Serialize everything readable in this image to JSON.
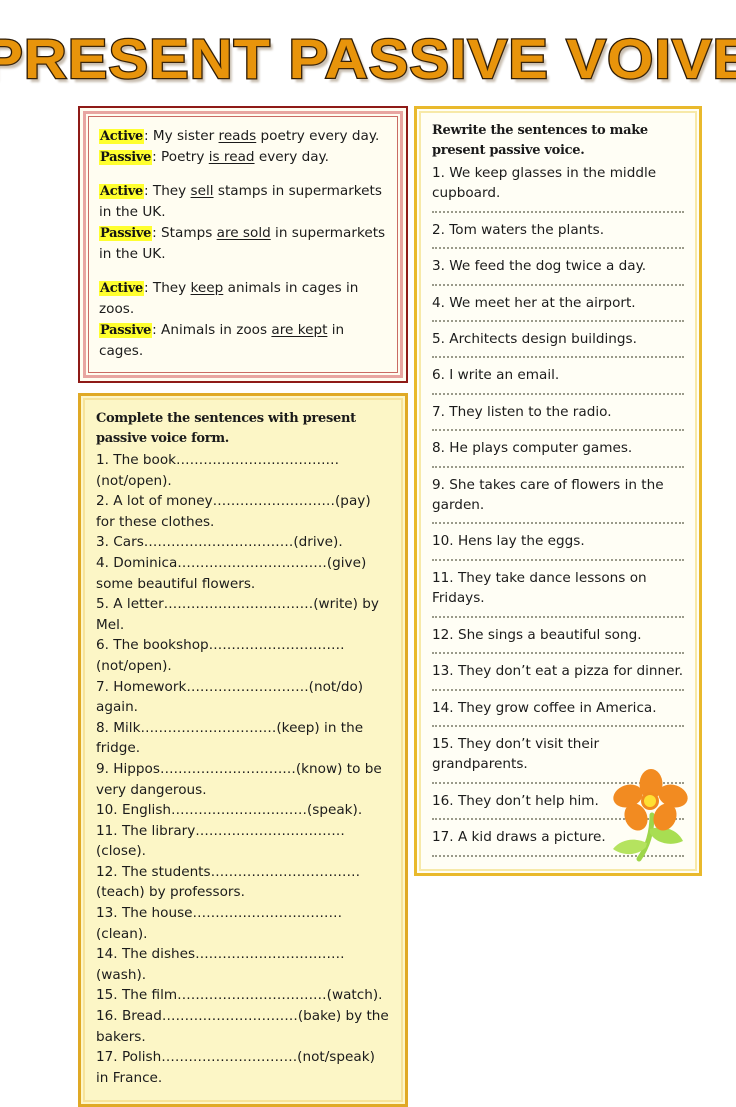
{
  "title": "PRESENT PASSIVE VOIVE",
  "colors": {
    "title_fill": "#E8940B",
    "title_outline": "#2b1a06",
    "example_border": "#8e1a17",
    "gold_border": "#e0a925",
    "gold_fill": "#fcf6c6",
    "ivory_fill": "#fffef5",
    "highlight": "#ffff2e",
    "flower_petal": "#F28B21",
    "flower_center": "#FFE033",
    "flower_stem": "#9ED64A"
  },
  "examples": {
    "label_active": "Active",
    "label_passive": "Passive",
    "groups": [
      {
        "active_pre": ": My sister ",
        "active_verb": "reads",
        "active_post": " poetry every day.",
        "passive_pre": ": Poetry ",
        "passive_verb": "is read",
        "passive_post": " every day."
      },
      {
        "active_pre": ": They ",
        "active_verb": "sell",
        "active_post": " stamps in supermarkets in the UK.",
        "passive_pre": ": Stamps ",
        "passive_verb": "are sold",
        "passive_post": " in supermarkets in the UK."
      },
      {
        "active_pre": ": They ",
        "active_verb": "keep",
        "active_post": " animals in cages in zoos.",
        "passive_pre": ": Animals in zoos ",
        "passive_verb": "are kept",
        "passive_post": " in cages."
      }
    ]
  },
  "complete": {
    "heading": "Complete the sentences with present passive voice form.",
    "items": [
      "1. The book………………………………(not/open).",
      "2. A lot of money………………………(pay) for these clothes.",
      "3. Cars……………………………(drive).",
      "4. Dominica……………………………(give) some beautiful flowers.",
      "5. A letter……………………………(write) by Mel.",
      "6. The bookshop…………………………(not/open).",
      "7. Homework………………………(not/do) again.",
      "8. Milk…………………………(keep) in the fridge.",
      "9. Hippos…………………………(know) to be very dangerous.",
      "10. English…………………………(speak).",
      "11. The library……………………………(close).",
      "12. The students……………………………(teach) by professors.",
      "13. The house……………………………(clean).",
      "14. The dishes……………………………(wash).",
      "15. The film……………………………(watch).",
      "16. Bread…………………………(bake) by the bakers.",
      "17. Polish…………………………(not/speak) in France."
    ]
  },
  "rewrite": {
    "heading": "Rewrite the sentences to make present passive voice.",
    "items": [
      "1. We keep glasses in the middle cupboard.",
      "2. Tom waters the plants.",
      "3. We feed the dog twice a day.",
      "4. We meet her at the airport.",
      "5. Architects design buildings.",
      "6. I write an email.",
      "7. They listen to the radio.",
      "8. He plays computer games.",
      "9. She takes care of flowers in the garden.",
      "10. Hens lay the eggs.",
      "11. They take dance lessons on Fridays.",
      "12. She sings a beautiful song.",
      "13. They don’t eat a pizza for dinner.",
      "14. They grow coffee in America.",
      "15. They don’t visit their grandparents.",
      "16. They don’t help him.",
      "17. A kid draws a picture."
    ]
  }
}
